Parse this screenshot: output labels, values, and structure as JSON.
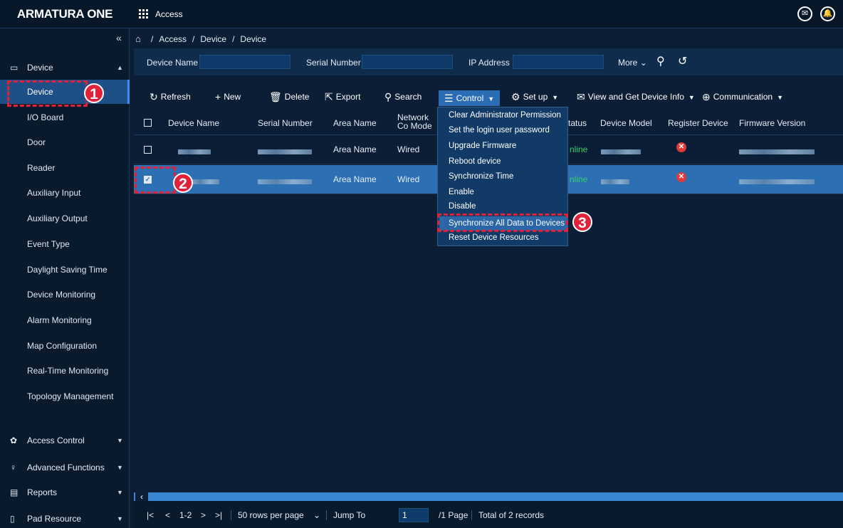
{
  "app": {
    "brand": "ARMATURA ONE",
    "module": "Access"
  },
  "sidebar": {
    "group_device": "Device",
    "items": [
      "Device",
      "I/O Board",
      "Door",
      "Reader",
      "Auxiliary Input",
      "Auxiliary Output",
      "Event Type",
      "Daylight Saving Time",
      "Device Monitoring",
      "Alarm Monitoring",
      "Map Configuration",
      "Real-Time Monitoring",
      "Topology Management"
    ],
    "groups_bottom": [
      "Access Control",
      "Advanced Functions",
      "Reports",
      "Pad Resource"
    ]
  },
  "breadcrumb": [
    "Access",
    "Device",
    "Device"
  ],
  "filters": {
    "device_name": "Device Name",
    "serial_number": "Serial Number",
    "ip_address": "IP Address",
    "more": "More"
  },
  "toolbar": {
    "refresh": "Refresh",
    "new": "New",
    "delete": "Delete",
    "export": "Export",
    "search": "Search",
    "control": "Control",
    "setup": "Set up",
    "view_info": "View and Get Device Info",
    "communication": "Communication"
  },
  "table": {
    "headers": {
      "device_name": "Device Name",
      "serial_number": "Serial Number",
      "area_name": "Area Name",
      "network": "Network Co Mode",
      "status": "tatus",
      "device_model": "Device Model",
      "register": "Register Device",
      "firmware": "Firmware Version"
    },
    "rows": [
      {
        "area": "Area Name",
        "network": "Wired",
        "status": "nline",
        "selected": false
      },
      {
        "area": "Area Name",
        "network": "Wired",
        "status": "nline",
        "selected": true
      }
    ]
  },
  "control_menu": [
    "Clear Administrator Permission",
    "Set the login user password",
    "Upgrade Firmware",
    "Reboot device",
    "Synchronize Time",
    "Enable",
    "Disable",
    "Synchronize All Data to Devices",
    "Reset Device Resources"
  ],
  "annotations": {
    "step1": "1",
    "step2": "2",
    "step3": "3"
  },
  "pager": {
    "range": "1-2",
    "rows_per_page": "50 rows per page",
    "jump_to": "Jump To",
    "jump_value": "1",
    "pages": "/1 Page",
    "total": "Total of 2 records"
  },
  "colors": {
    "accent": "#2c6fb3",
    "annotation": "#e0213a",
    "online": "#31d36a"
  }
}
